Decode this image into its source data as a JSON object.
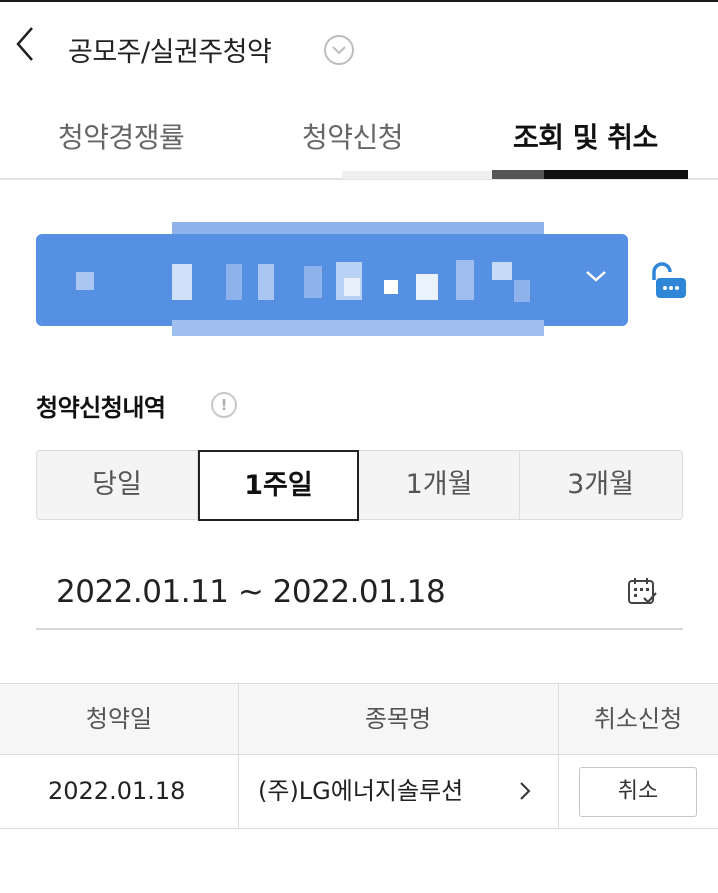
{
  "header": {
    "title": "공모주/실권주청약",
    "back_icon": "chevron-left-icon",
    "dropdown_icon": "chevron-down-circle-icon"
  },
  "tabs": [
    {
      "label": "청약경쟁률",
      "active": false
    },
    {
      "label": "청약신청",
      "active": false
    },
    {
      "label": "조회 및 취소",
      "active": true
    }
  ],
  "account": {
    "masked": true,
    "color": "#5690e3",
    "chevron_icon": "chevron-down-icon",
    "lock_icon": "unlock-password-icon"
  },
  "history": {
    "title": "청약신청내역",
    "info_symbol": "!",
    "periods": [
      {
        "label": "당일",
        "active": false
      },
      {
        "label": "1주일",
        "active": true
      },
      {
        "label": "1개월",
        "active": false
      },
      {
        "label": "3개월",
        "active": false
      }
    ],
    "date_range": "2022.01.11 ~ 2022.01.18",
    "calendar_icon": "calendar-icon"
  },
  "table": {
    "headers": [
      "청약일",
      "종목명",
      "취소신청"
    ],
    "rows": [
      {
        "date": "2022.01.18",
        "name": "(주)LG에너지솔루션",
        "action": "취소"
      }
    ]
  }
}
